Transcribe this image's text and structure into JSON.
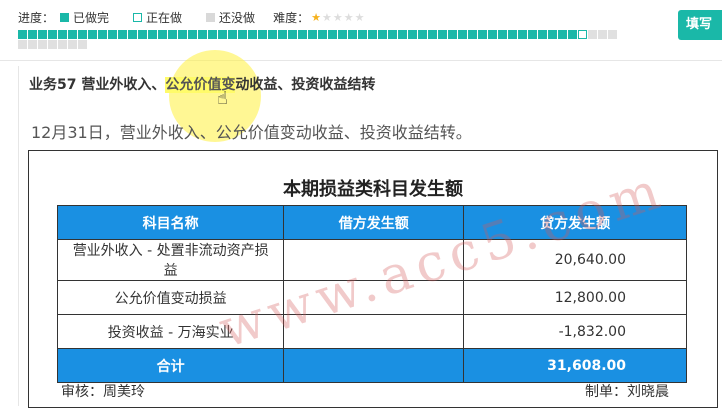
{
  "legend": {
    "progress_label": "进度：",
    "done_label": "已做完",
    "doing_label": "正在做",
    "todo_label": "还没做",
    "difficulty_label": "难度：",
    "difficulty_rating": 1,
    "difficulty_max": 5,
    "colors": {
      "done": "#1ab8a8",
      "todo": "#d9d9d9"
    }
  },
  "progress": {
    "done_count": 56,
    "current_index": 56,
    "todo_count": 10
  },
  "header": {
    "fill_button_label": "填写"
  },
  "task": {
    "title_prefix": "业务57 营业外收入、",
    "title_highlight": "公允价值变",
    "title_suffix": "动收益、投资收益结转",
    "description": "12月31日，营业外收入、公允价值变动收益、投资收益结转。"
  },
  "document": {
    "title": "本期损益类科目发生额",
    "headers": [
      "科目名称",
      "借方发生额",
      "贷方发生额"
    ],
    "rows": [
      {
        "name": "营业外收入 - 处置非流动资产损益",
        "debit": "",
        "credit": "20,640.00"
      },
      {
        "name": "公允价值变动损益",
        "debit": "",
        "credit": "12,800.00"
      },
      {
        "name": "投资收益 - 万海实业",
        "debit": "",
        "credit": "-1,832.00"
      }
    ],
    "total": {
      "label": "合计",
      "debit": "",
      "credit": "31,608.00"
    },
    "reviewer": "审核：周美玲",
    "preparer": "制单：刘晓晨",
    "header_color": "#1a90e2"
  },
  "watermark": "www.acc5.com"
}
